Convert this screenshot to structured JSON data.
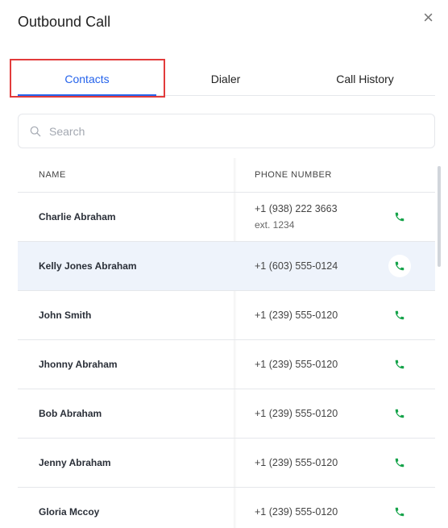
{
  "dialog": {
    "title": "Outbound Call",
    "close_label": "×"
  },
  "tabs": [
    {
      "label": "Contacts",
      "active": true
    },
    {
      "label": "Dialer",
      "active": false
    },
    {
      "label": "Call History",
      "active": false
    }
  ],
  "search": {
    "placeholder": "Search",
    "value": ""
  },
  "table": {
    "headers": {
      "name": "NAME",
      "phone": "PHONE NUMBER"
    },
    "rows": [
      {
        "name": "Charlie Abraham",
        "phone": "+1 (938) 222 3663",
        "ext": "ext. 1234"
      },
      {
        "name": "Kelly Jones Abraham",
        "phone": "+1 (603) 555-0124",
        "selected": true
      },
      {
        "name": "John Smith",
        "phone": "+1 (239) 555-0120"
      },
      {
        "name": "Jhonny Abraham",
        "phone": "+1 (239) 555-0120"
      },
      {
        "name": "Bob Abraham",
        "phone": "+1 (239) 555-0120"
      },
      {
        "name": "Jenny Abraham",
        "phone": "+1 (239) 555-0120"
      },
      {
        "name": "Gloria Mccoy",
        "phone": "+1 (239) 555-0120"
      }
    ]
  },
  "icons": {
    "call": "phone-icon",
    "search": "search-icon",
    "close": "close-icon"
  },
  "colors": {
    "accent": "#2563eb",
    "call_green": "#16a34a",
    "selected_row": "#eef3fb",
    "highlight_box": "#e23b3b"
  }
}
